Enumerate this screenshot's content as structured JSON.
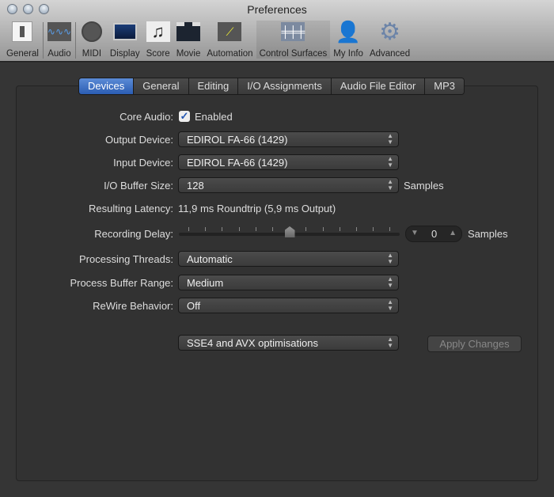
{
  "window": {
    "title": "Preferences"
  },
  "toolbar": [
    {
      "label": "General",
      "icon": "switch-icon"
    },
    {
      "label": "Audio",
      "icon": "waveform-icon"
    },
    {
      "label": "MIDI",
      "icon": "midi-port-icon"
    },
    {
      "label": "Display",
      "icon": "monitor-icon"
    },
    {
      "label": "Score",
      "icon": "music-notes-icon"
    },
    {
      "label": "Movie",
      "icon": "clapperboard-icon"
    },
    {
      "label": "Automation",
      "icon": "automation-curve-icon"
    },
    {
      "label": "Control Surfaces",
      "icon": "faders-icon",
      "selected": true
    },
    {
      "label": "My Info",
      "icon": "user-silhouette-icon"
    },
    {
      "label": "Advanced",
      "icon": "gear-icon"
    }
  ],
  "tabs": [
    "Devices",
    "General",
    "Editing",
    "I/O Assignments",
    "Audio File Editor",
    "MP3"
  ],
  "form": {
    "core_audio": {
      "label": "Core Audio:",
      "checkbox": "Enabled",
      "checked": true
    },
    "output_device": {
      "label": "Output Device:",
      "value": "EDIROL FA-66 (1429)"
    },
    "input_device": {
      "label": "Input Device:",
      "value": "EDIROL FA-66 (1429)"
    },
    "buffer": {
      "label": "I/O Buffer Size:",
      "value": "128",
      "unit": "Samples"
    },
    "latency": {
      "label": "Resulting Latency:",
      "value": "11,9 ms Roundtrip (5,9 ms Output)"
    },
    "recording_delay": {
      "label": "Recording Delay:",
      "value": "0",
      "unit": "Samples",
      "slider_fraction": 0.5
    },
    "threads": {
      "label": "Processing Threads:",
      "value": "Automatic"
    },
    "buffer_range": {
      "label": "Process Buffer Range:",
      "value": "Medium"
    },
    "rewire": {
      "label": "ReWire Behavior:",
      "value": "Off"
    },
    "optim": {
      "value": "SSE4 and AVX optimisations"
    },
    "apply": "Apply Changes"
  }
}
